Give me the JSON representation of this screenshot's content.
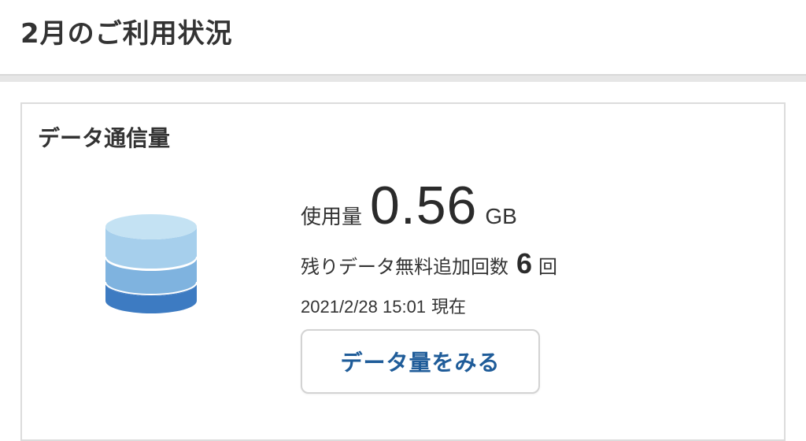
{
  "header": {
    "title": "2月のご利用状況"
  },
  "data_card": {
    "title": "データ通信量",
    "icon": "database-icon",
    "icon_colors": {
      "top": "#b9dcf0",
      "middle": "#7fb3df",
      "bottom": "#3d7bc2"
    },
    "usage": {
      "label": "使用量",
      "value": "0.56",
      "unit": "GB"
    },
    "remaining": {
      "label": "残りデータ無料追加回数",
      "count": "6",
      "unit": "回"
    },
    "timestamp": {
      "value": "2021/2/28 15:01",
      "suffix": "現在"
    },
    "button": {
      "label": "データ量をみる",
      "color": "#1f5c99"
    }
  }
}
